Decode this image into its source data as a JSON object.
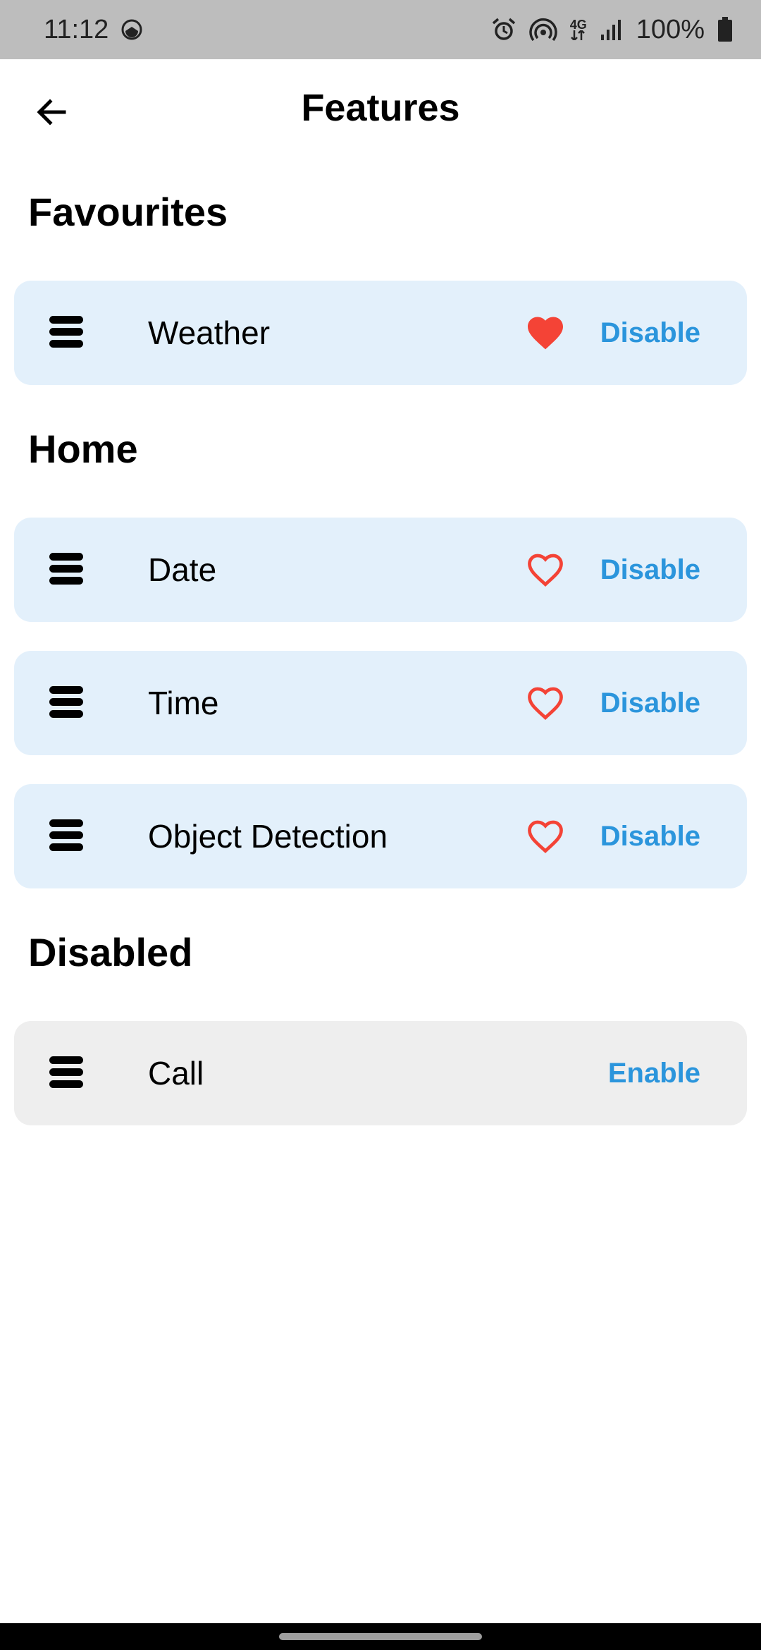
{
  "status_bar": {
    "time": "11:12",
    "network": "4G",
    "battery": "100%",
    "icons": [
      "data-saver-icon",
      "alarm-icon",
      "hotspot-icon",
      "network-4g-icon",
      "signal-icon",
      "battery-icon"
    ]
  },
  "app_bar": {
    "title": "Features",
    "back_icon": "arrow-left-icon"
  },
  "sections": {
    "favourites": {
      "title": "Favourites",
      "items": [
        {
          "label": "Weather",
          "favourite": true,
          "action": "Disable"
        }
      ]
    },
    "home": {
      "title": "Home",
      "items": [
        {
          "label": "Date",
          "favourite": false,
          "action": "Disable"
        },
        {
          "label": "Time",
          "favourite": false,
          "action": "Disable"
        },
        {
          "label": "Object Detection",
          "favourite": false,
          "action": "Disable"
        }
      ]
    },
    "disabled": {
      "title": "Disabled",
      "items": [
        {
          "label": "Call",
          "action": "Enable"
        }
      ]
    }
  },
  "colors": {
    "status_bar": "#bdbdbd",
    "card_enabled": "#e3f0fb",
    "card_disabled": "#eeeeee",
    "accent": "#2b95dc",
    "heart": "#f44336"
  }
}
